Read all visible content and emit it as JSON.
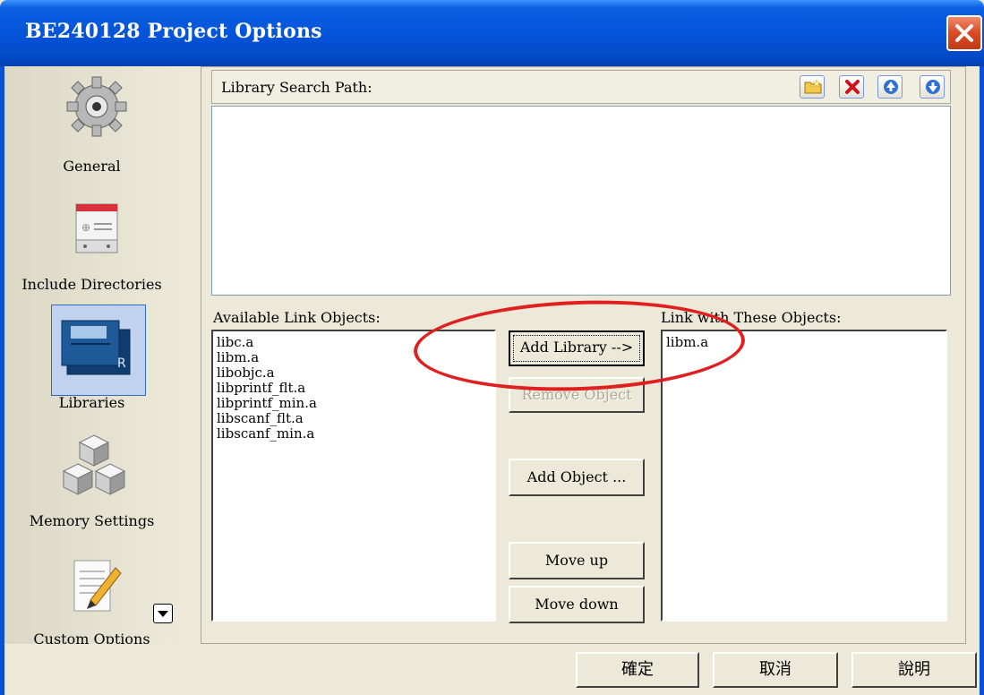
{
  "window": {
    "title": "BE240128 Project Options",
    "close_icon": "close-icon"
  },
  "sidebar": {
    "items": [
      {
        "label": "General",
        "icon": "gear-icon"
      },
      {
        "label": "Include Directories",
        "icon": "directory-icon"
      },
      {
        "label": "Libraries",
        "icon": "books-icon",
        "selected": true
      },
      {
        "label": "Memory Settings",
        "icon": "cubes-icon"
      },
      {
        "label": "Custom Options",
        "icon": "notepad-pencil-icon"
      }
    ],
    "scroll_icon": "chevron-down-icon"
  },
  "search_path": {
    "label": "Library Search Path:",
    "toolbar": [
      "folder-icon",
      "delete-icon",
      "arrow-up-icon",
      "arrow-down-icon"
    ]
  },
  "available": {
    "label": "Available Link Objects:",
    "items": [
      "libc.a",
      "libm.a",
      "libobjc.a",
      "libprintf_flt.a",
      "libprintf_min.a",
      "libscanf_flt.a",
      "libscanf_min.a"
    ]
  },
  "linked": {
    "label": "Link with These Objects:",
    "items": [
      "libm.a"
    ]
  },
  "buttons": {
    "add_library": "Add Library -->",
    "remove_object": "Remove Object",
    "add_object": "Add Object ...",
    "move_up": "Move up",
    "move_down": "Move down"
  },
  "dialog_buttons": {
    "ok": "確定",
    "cancel": "取消",
    "help": "說明"
  },
  "colors": {
    "title_bar": "#0553d8",
    "annotation": "#e02020",
    "selection": "#c1d2ee"
  }
}
